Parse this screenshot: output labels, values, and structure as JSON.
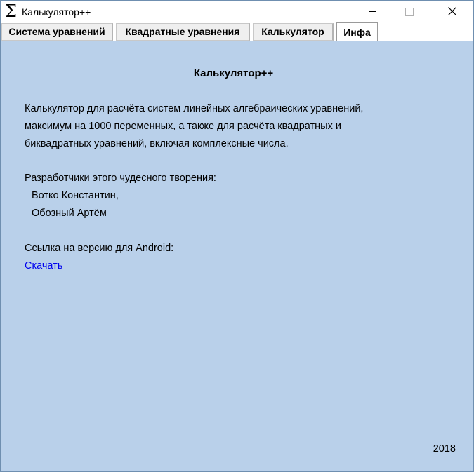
{
  "window": {
    "icon_glyph": "Σ",
    "icon": "sigma-icon",
    "title": "Калькулятор++"
  },
  "tabs": [
    {
      "label": "Система уравнений"
    },
    {
      "label": "Квадратные уравнения"
    },
    {
      "label": "Калькулятор"
    },
    {
      "label": "Инфа",
      "selected": true
    }
  ],
  "content": {
    "heading": "Калькулятор++",
    "description_lines": [
      "Калькулятор для расчёта систем линейных алгебраических уравнений,",
      "максимум на 1000 переменных, а также для расчёта квадратных и",
      "биквадратных уравнений, включая комплексные числа."
    ],
    "developers_label": "Разработчики этого чудесного творения:",
    "developers": [
      "Вотко Константин,",
      "Обозный Артём"
    ],
    "android_label": "Ссылка на версию для Android:",
    "download_link": "Скачать",
    "year": "2018"
  },
  "colors": {
    "content_background": "#b9d0ea",
    "link": "#0000ee"
  }
}
